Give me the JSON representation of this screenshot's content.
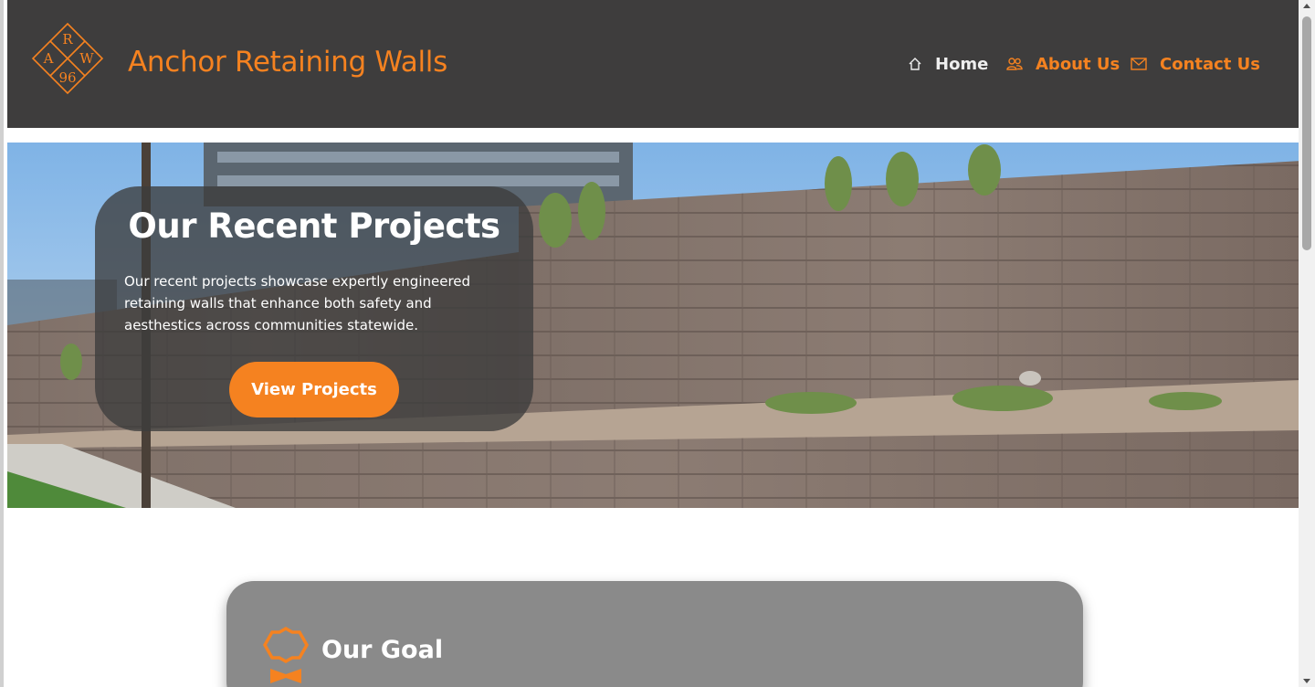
{
  "header": {
    "logo_letters": [
      "R",
      "A",
      "W",
      "96"
    ],
    "brand_name": "Anchor Retaining Walls",
    "nav": {
      "home": "Home",
      "about": "About Us",
      "contact": "Contact Us"
    }
  },
  "hero": {
    "title": "Our Recent Projects",
    "description": "Our recent projects showcase expertly engineered retaining walls that enhance both safety and aesthestics across communities statewide.",
    "button_label": "View Projects"
  },
  "goal": {
    "title": "Our Goal"
  },
  "colors": {
    "accent": "#f58220",
    "header_bg": "#3e3d3d",
    "card_bg": "#8a8a8a"
  },
  "icons": {
    "home": "home-icon",
    "about": "users-icon",
    "contact": "mail-icon",
    "goal": "award-ribbon-icon"
  }
}
